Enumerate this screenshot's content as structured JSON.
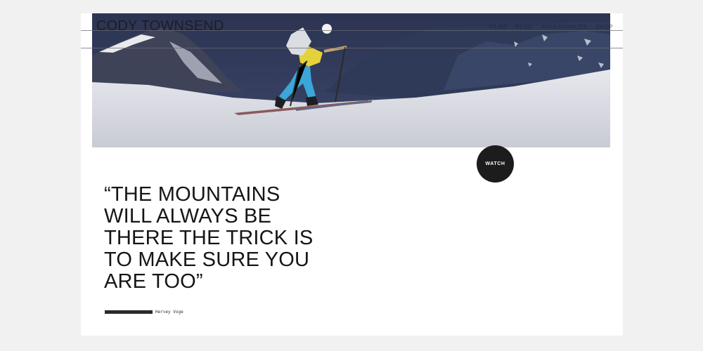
{
  "header": {
    "brand": "CODY TOWNSEND",
    "nav": [
      "Films",
      "Blog",
      "Appearances",
      "Shop"
    ]
  },
  "hero": {
    "image_alt": "Ski mountaineer skinning up a snowy slope",
    "watch_label": "WATCH"
  },
  "quote": {
    "text": "“THE MOUNTAINS WILL ALWAYS BE THERE THE TRICK IS TO MAKE SURE YOU ARE TOO”",
    "author": "Hervey Voge"
  },
  "colors": {
    "page_bg": "#f2f1f2",
    "panel_bg": "#ffffff",
    "text": "#151515",
    "watch_button": "#1c1c1c"
  }
}
